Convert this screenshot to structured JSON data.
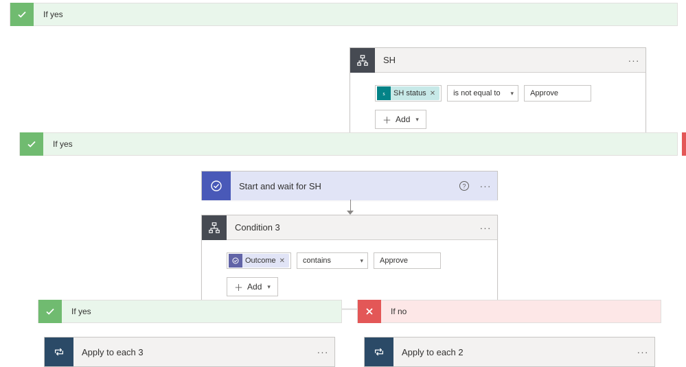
{
  "outer": {
    "ifyes_label": "If yes"
  },
  "sh": {
    "title": "SH",
    "pill_label": "SH status",
    "operator": "is not equal to",
    "value": "Approve",
    "add_label": "Add"
  },
  "mid": {
    "ifyes_label": "If yes"
  },
  "approval": {
    "title": "Start and wait for SH"
  },
  "cond3": {
    "title": "Condition 3",
    "pill_label": "Outcome",
    "operator": "contains",
    "value": "Approve",
    "add_label": "Add"
  },
  "branches": {
    "yes_label": "If yes",
    "no_label": "If no",
    "apply3_title": "Apply to each 3",
    "apply2_title": "Apply to each 2"
  }
}
